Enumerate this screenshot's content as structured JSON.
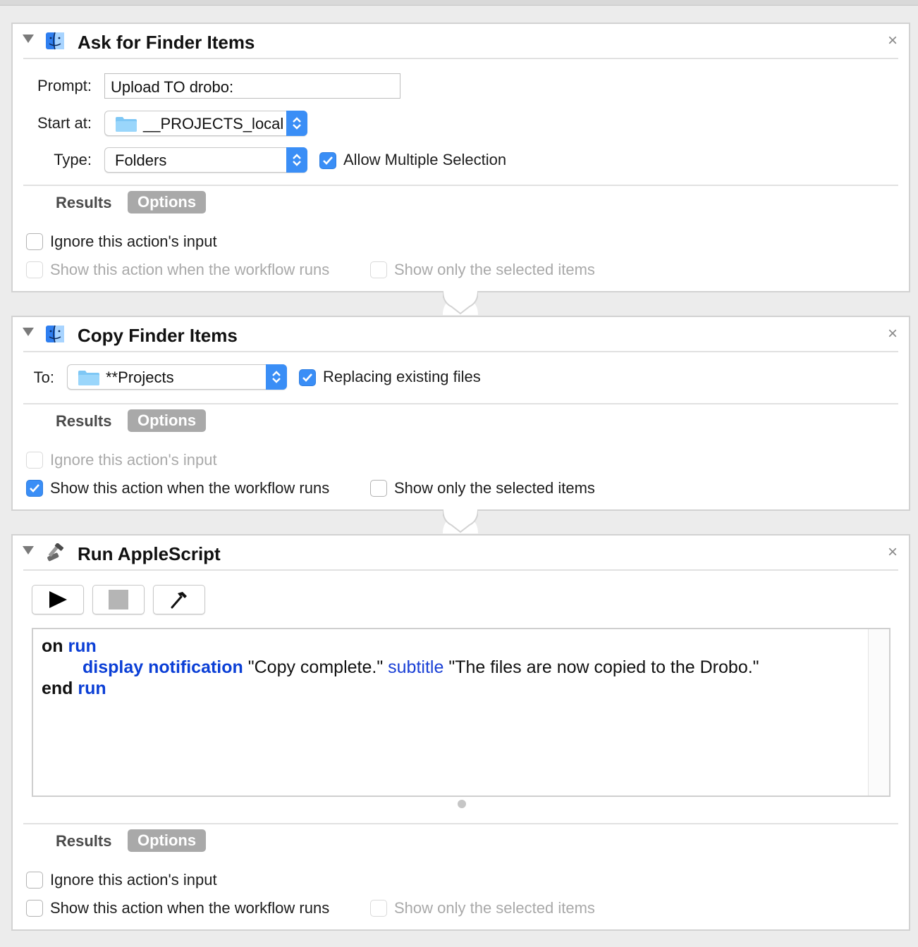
{
  "actions": [
    {
      "title": "Ask for Finder Items",
      "close": "×",
      "icon": "finder-icon",
      "prompt_label": "Prompt:",
      "prompt_value": "Upload TO drobo:",
      "start_label": "Start at:",
      "start_value": "__PROJECTS_local",
      "type_label": "Type:",
      "type_value": "Folders",
      "allow_multiple": "Allow Multiple Selection",
      "results": "Results",
      "options": "Options",
      "ignore_input": "Ignore this action's input",
      "show_action": "Show this action when the workflow runs",
      "show_selected": "Show only the selected items"
    },
    {
      "title": "Copy Finder Items",
      "close": "×",
      "icon": "finder-icon",
      "to_label": "To:",
      "to_value": "**Projects",
      "replacing": "Replacing existing files",
      "results": "Results",
      "options": "Options",
      "ignore_input": "Ignore this action's input",
      "show_action": "Show this action when the workflow runs",
      "show_selected": "Show only the selected items"
    },
    {
      "title": "Run AppleScript",
      "close": "×",
      "icon": "applescript-icon",
      "code": {
        "l1_kw": "on",
        "l1_handler": "run",
        "l2_cmd": "display notification",
        "l2_str1": "\"Copy complete.\"",
        "l2_param": "subtitle",
        "l2_str2": "\"The files are now copied to the Drobo.\"",
        "l3_kw": "end",
        "l3_handler": "run"
      },
      "results": "Results",
      "options": "Options",
      "ignore_input": "Ignore this action's input",
      "show_action": "Show this action when the workflow runs",
      "show_selected": "Show only the selected items"
    }
  ],
  "colors": {
    "accent": "#3a8ef6",
    "keyword_blue": "#0b3fd6",
    "options_bg": "#a9a9a9"
  }
}
